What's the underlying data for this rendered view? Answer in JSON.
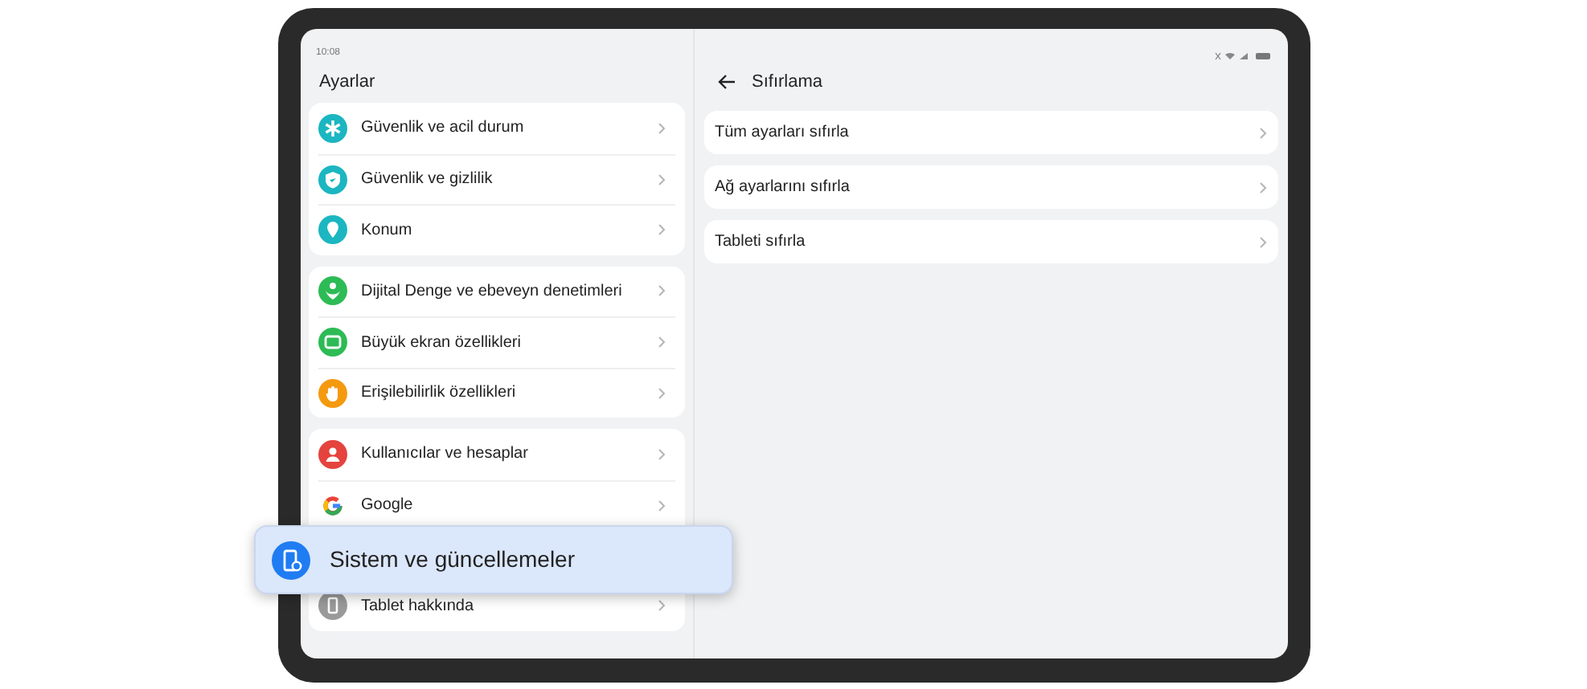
{
  "status_bar": {
    "time": "10:08"
  },
  "sidebar": {
    "title": "Ayarlar",
    "groups": [
      {
        "items": [
          {
            "label": "Güvenlik ve acil durum",
            "color": "#1bb6c1"
          },
          {
            "label": "Güvenlik ve gizlilik",
            "color": "#1bb6c1"
          },
          {
            "label": "Konum",
            "color": "#1bb6c1"
          }
        ]
      },
      {
        "items": [
          {
            "label": "Dijital Denge ve ebeveyn denetimleri",
            "color": "#2dbb55"
          },
          {
            "label": "Büyük ekran özellikleri",
            "color": "#2dbb55"
          },
          {
            "label": "Erişilebilirlik özellikleri",
            "color": "#f5990f"
          }
        ]
      },
      {
        "items": [
          {
            "label": "Kullanıcılar ve hesaplar",
            "color": "#e5433d"
          },
          {
            "label": "Google",
            "color": "#ffffff"
          },
          {
            "label": "Tablet hakkında",
            "color": "#9a9a9a"
          }
        ]
      }
    ]
  },
  "highlight": {
    "label": "Sistem ve güncellemeler"
  },
  "detail": {
    "title": "Sıfırlama",
    "items": [
      {
        "label": "Tüm ayarları sıfırla"
      },
      {
        "label": "Ağ ayarlarını sıfırla"
      },
      {
        "label": "Tableti sıfırla"
      }
    ]
  }
}
